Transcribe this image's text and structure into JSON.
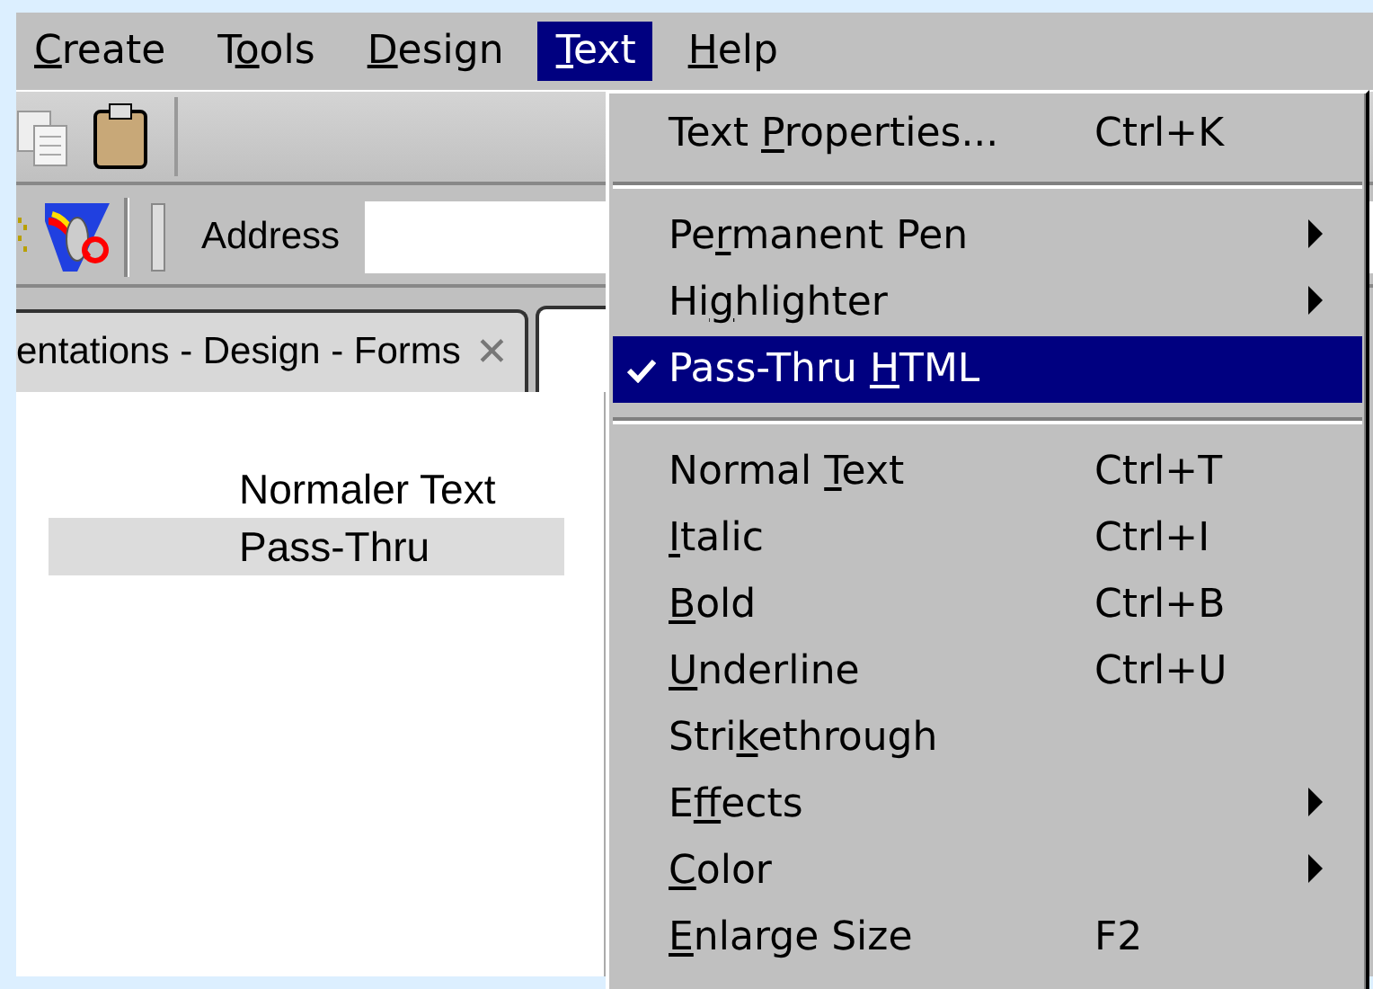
{
  "menu_bar": [
    {
      "key": "C",
      "post": "reate",
      "selected": false
    },
    {
      "pre": "T",
      "key": "o",
      "post": "ols",
      "selected": false
    },
    {
      "key": "D",
      "post": "esign",
      "selected": false
    },
    {
      "key": "T",
      "post": "ext",
      "selected": true
    },
    {
      "key": "H",
      "post": "elp",
      "selected": false
    }
  ],
  "toolbar": {
    "address_label": "Address"
  },
  "document_tab": {
    "title": "entations - Design - Forms",
    "close": "✕"
  },
  "editor": {
    "lines": [
      {
        "text": "Normaler Text",
        "pass_thru": false
      },
      {
        "text": "Pass-Thru",
        "pass_thru": true
      }
    ]
  },
  "text_menu": [
    {
      "kind": "item",
      "pre": "Text ",
      "key": "P",
      "post": "roperties...",
      "shortcut": "Ctrl+K",
      "submenu": false,
      "checked": false,
      "selected": false
    },
    {
      "kind": "separator"
    },
    {
      "kind": "item",
      "pre": "Pe",
      "key": "r",
      "post": "manent Pen",
      "submenu": true,
      "checked": false,
      "selected": false
    },
    {
      "kind": "item",
      "pre": "Hi",
      "key": "g",
      "post": "hlighter",
      "submenu": true,
      "checked": false,
      "selected": false
    },
    {
      "kind": "item",
      "pre": "Pass-Thru ",
      "key": "H",
      "post": "TML",
      "submenu": false,
      "checked": true,
      "selected": true
    },
    {
      "kind": "separator"
    },
    {
      "kind": "item",
      "pre": "Normal ",
      "key": "T",
      "post": "ext",
      "shortcut": "Ctrl+T",
      "submenu": false,
      "checked": false,
      "selected": false
    },
    {
      "kind": "item",
      "key": "I",
      "post": "talic",
      "shortcut": "Ctrl+I",
      "submenu": false,
      "checked": false,
      "selected": false
    },
    {
      "kind": "item",
      "key": "B",
      "post": "old",
      "shortcut": "Ctrl+B",
      "submenu": false,
      "checked": false,
      "selected": false
    },
    {
      "kind": "item",
      "key": "U",
      "post": "nderline",
      "shortcut": "Ctrl+U",
      "submenu": false,
      "checked": false,
      "selected": false
    },
    {
      "kind": "item",
      "pre": "Stri",
      "key": "k",
      "post": "ethrough",
      "submenu": false,
      "checked": false,
      "selected": false
    },
    {
      "kind": "item",
      "pre": "E",
      "key": "f",
      "post": "fects",
      "submenu": true,
      "checked": false,
      "selected": false
    },
    {
      "kind": "item",
      "key": "C",
      "post": "olor",
      "submenu": true,
      "checked": false,
      "selected": false
    },
    {
      "kind": "item",
      "key": "E",
      "post": "nlarge Size",
      "shortcut": "F2",
      "submenu": false,
      "checked": false,
      "selected": false
    }
  ]
}
